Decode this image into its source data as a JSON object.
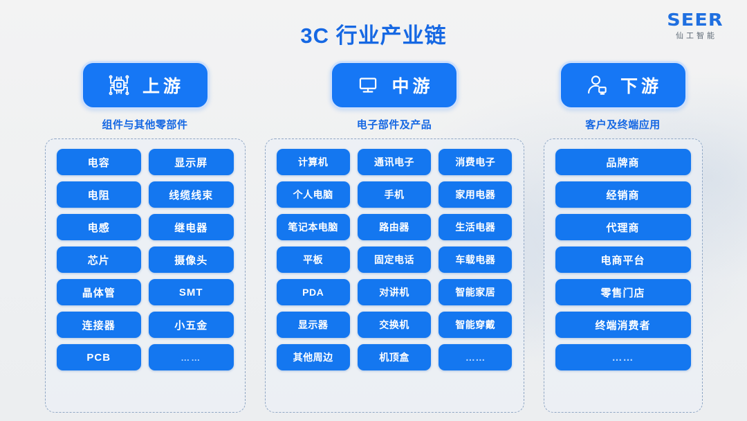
{
  "page": {
    "title": "3C 行业产业链",
    "background_color": "#f1f1f1",
    "accent_color": "#1677f5"
  },
  "logo": {
    "mark": "SEER",
    "subtitle": "仙工智能"
  },
  "columns": [
    {
      "id": "upstream",
      "icon": "chip-icon",
      "label": "上游",
      "subtitle": "组件与其他零部件",
      "rows": [
        [
          "电容",
          "显示屏"
        ],
        [
          "电阻",
          "线缆线束"
        ],
        [
          "电感",
          "继电器"
        ],
        [
          "芯片",
          "摄像头"
        ],
        [
          "晶体管",
          "SMT"
        ],
        [
          "连接器",
          "小五金"
        ],
        [
          "PCB",
          "……"
        ]
      ]
    },
    {
      "id": "midstream",
      "icon": "monitor-icon",
      "label": "中游",
      "subtitle": "电子部件及产品",
      "rows": [
        [
          "计算机",
          "通讯电子",
          "消费电子"
        ],
        [
          "个人电脑",
          "手机",
          "家用电器"
        ],
        [
          "笔记本电脑",
          "路由器",
          "生活电器"
        ],
        [
          "平板",
          "固定电话",
          "车载电器"
        ],
        [
          "PDA",
          "对讲机",
          "智能家居"
        ],
        [
          "显示器",
          "交换机",
          "智能穿戴"
        ],
        [
          "其他周边",
          "机顶盒",
          "……"
        ]
      ]
    },
    {
      "id": "downstream",
      "icon": "person-device-icon",
      "label": "下游",
      "subtitle": "客户及终端应用",
      "rows": [
        [
          "品牌商"
        ],
        [
          "经销商"
        ],
        [
          "代理商"
        ],
        [
          "电商平台"
        ],
        [
          "零售门店"
        ],
        [
          "终端消费者"
        ],
        [
          "……"
        ]
      ]
    }
  ]
}
